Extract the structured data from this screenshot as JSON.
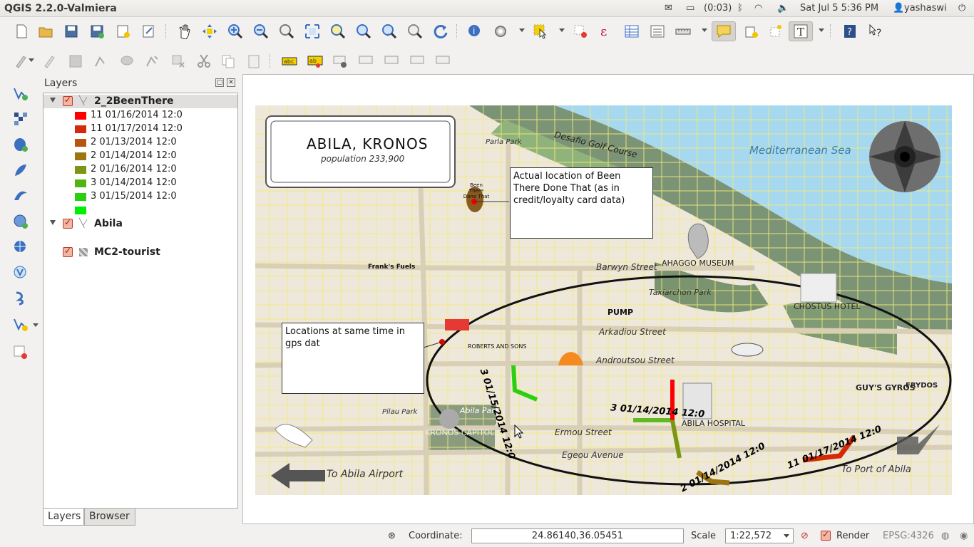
{
  "window": {
    "title": "QGIS 2.2.0-Valmiera"
  },
  "tray": {
    "battery": "(0:03)",
    "datetime": "Sat Jul  5  5:36 PM",
    "user": "yashaswi"
  },
  "layers_panel": {
    "title": "Layers",
    "layers": [
      {
        "name": "2_2BeenThere",
        "legend": [
          {
            "label": "11 01/16/2014 12:0",
            "color": "#ff0000"
          },
          {
            "label": "11 01/17/2014 12:0",
            "color": "#d42a0a"
          },
          {
            "label": "2 01/13/2014 12:0",
            "color": "#b85412"
          },
          {
            "label": "2 01/14/2014 12:0",
            "color": "#9c7410"
          },
          {
            "label": "2 01/16/2014 12:0",
            "color": "#7a9612"
          },
          {
            "label": "3 01/14/2014 12:0",
            "color": "#52b412"
          },
          {
            "label": "3 01/15/2014 12:0",
            "color": "#2ad00e"
          },
          {
            "label": "",
            "color": "#00ee00"
          }
        ]
      },
      {
        "name": "Abila"
      },
      {
        "name": "MC2-tourist"
      }
    ],
    "tabs": [
      "Layers",
      "Browser"
    ]
  },
  "map": {
    "title": "ABILA, KRONOS",
    "population": "population 233,900",
    "sea": "Mediterranean Sea",
    "annotations": [
      "Actual location of Been There Done That (as in credit/loyalty card data)",
      "Locations at same time in gps dat"
    ],
    "labels": {
      "golf": "Desafio Golf Course",
      "park_top": "Parla Park",
      "barwyn": "Barwyn Street",
      "museum": "AHAGGO MUSEUM",
      "taxiarchon": "Taxiarchon Park",
      "chostus": "CHOSTUS HOTEL",
      "arkadiou": "Arkadiou Street",
      "androutsou": "Androutsou Street",
      "abila_park": "Abila Park",
      "kronos_capitol": "KRONOS CAPITOL",
      "ermou": "Ermou Street",
      "egeou": "Egeou Avenue",
      "hospital": "ABILA HOSPITAL",
      "airport": "To Abila Airport",
      "port": "To Port of Abila",
      "pilau": "Pilau Park",
      "guys": "GUY'S GYROS",
      "frydos": "FRYDOS",
      "pump": "PUMP",
      "roberts": "ROBERTS AND SONS",
      "frank": "Frank's Fuels",
      "been_there": "Been There Done That"
    },
    "track_labels": [
      "3 01/15/2014 12:0",
      "3 01/14/2014 12:0",
      "2 01/14/2014 12:0",
      "11 01/17/2014 12:0"
    ]
  },
  "status": {
    "coordinate_label": "Coordinate:",
    "coordinate_value": "24.86140,36.05451",
    "scale_label": "Scale",
    "scale_value": "1:22,572",
    "render_label": "Render",
    "crs": "EPSG:4326"
  }
}
